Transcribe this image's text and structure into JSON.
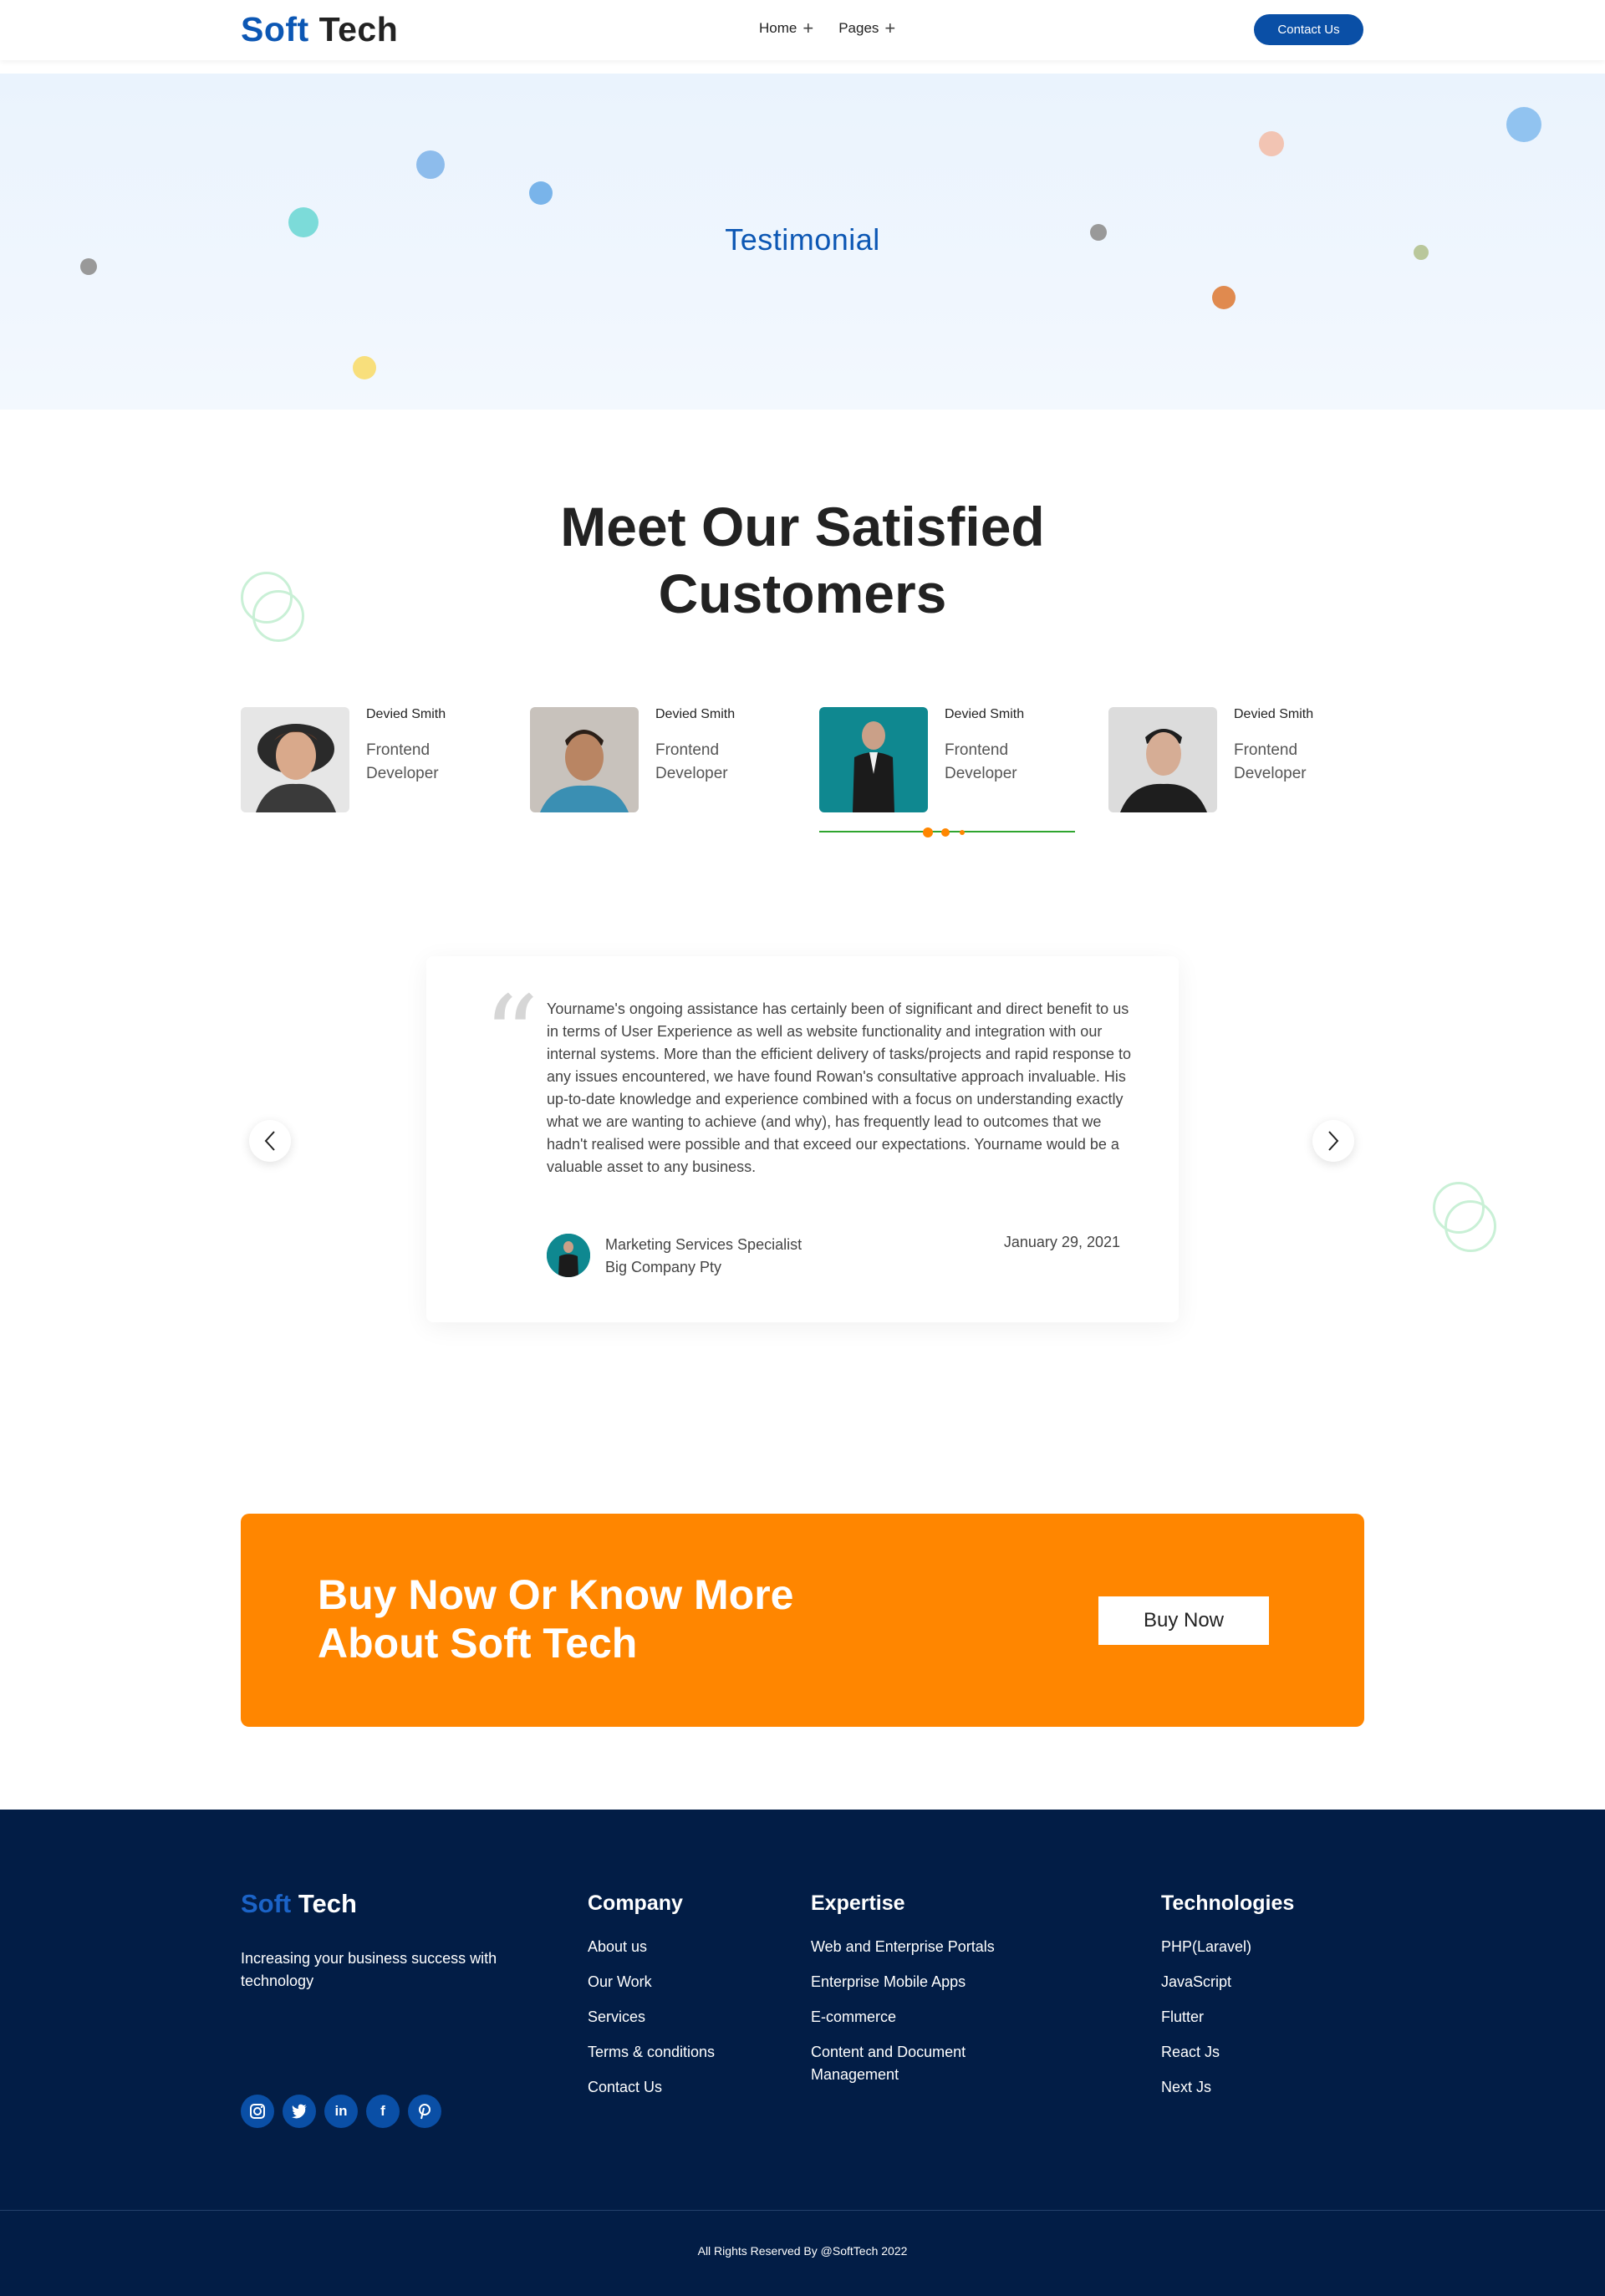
{
  "header": {
    "logo_part1": "Soft",
    "logo_part2": "Tech",
    "menu": [
      {
        "label": "Home",
        "icon": "plus-icon"
      },
      {
        "label": "Pages",
        "icon": "plus-icon"
      }
    ],
    "contact_label": "Contact Us"
  },
  "hero": {
    "title": "Testimonial"
  },
  "section": {
    "title_line1": "Meet Our Satisfied",
    "title_line2": "Customers"
  },
  "profiles": [
    {
      "name": "Devied Smith",
      "role": "Frontend Developer"
    },
    {
      "name": "Devied Smith",
      "role": "Frontend Developer"
    },
    {
      "name": "Devied Smith",
      "role": "Frontend Developer"
    },
    {
      "name": "Devied Smith",
      "role": "Frontend Developer"
    }
  ],
  "testimonial": {
    "text": "Yourname's ongoing assistance has certainly been of significant and direct benefit to us in terms of User Experience as well as website functionality and integration with our internal systems. More than the efficient delivery of tasks/projects and rapid response to any issues encountered, we have found Rowan's consultative approach invaluable. His up-to-date knowledge and experience combined with a focus on understanding exactly what we are wanting to achieve (and why), has frequently lead to outcomes that we hadn't realised were possible and that exceed our expectations. Yourname would be a valuable asset to any business.",
    "author_role": "Marketing Services Specialist",
    "author_company": "Big Company Pty",
    "date": "January 29, 2021"
  },
  "cta": {
    "title_line1": "Buy Now Or Know More",
    "title_line2": "About Soft Tech",
    "button": "Buy Now"
  },
  "footer": {
    "logo_part1": "Soft",
    "logo_part2": "Tech",
    "tagline": "Increasing your business success with technology",
    "columns": [
      {
        "title": "Company",
        "links": [
          "About us",
          "Our Work",
          "Services",
          "Terms & conditions",
          "Contact Us"
        ]
      },
      {
        "title": "Expertise",
        "links": [
          "Web and Enterprise Portals",
          "Enterprise Mobile Apps",
          "E-commerce",
          "Content and Document Management"
        ]
      },
      {
        "title": "Technologies",
        "links": [
          "PHP(Laravel)",
          "JavaScript",
          "Flutter",
          "React Js",
          "Next Js"
        ]
      }
    ],
    "socials": [
      "instagram-icon",
      "twitter-icon",
      "linkedin-icon",
      "facebook-icon",
      "pinterest-icon"
    ],
    "copyright": "All Rights Reserved By @SoftTech 2022"
  },
  "colors": {
    "brand_blue": "#0c57b4",
    "accent_orange": "#ff8600",
    "footer_bg": "#021d46"
  }
}
